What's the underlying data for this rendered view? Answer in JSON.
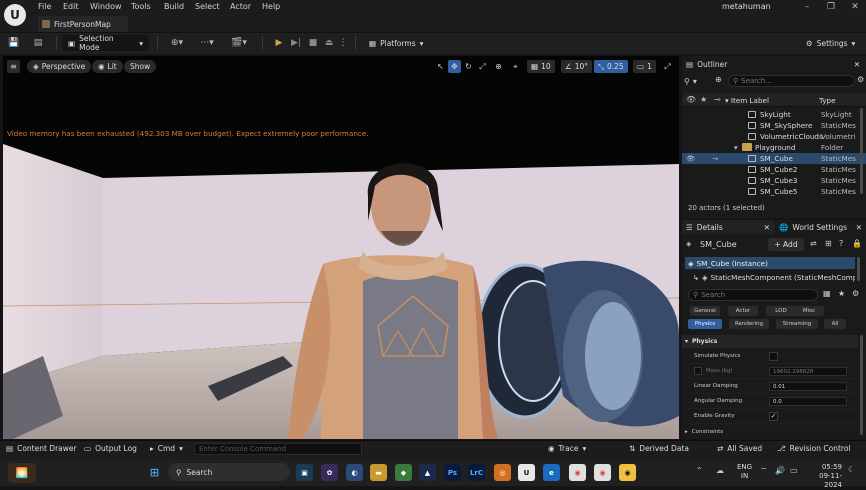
{
  "app": {
    "menus": [
      "File",
      "Edit",
      "Window",
      "Tools",
      "Build",
      "Select",
      "Actor",
      "Help"
    ],
    "doc_tab": "FirstPersonMap",
    "window_title": "metahuman"
  },
  "toolbar": {
    "selection_mode": "Selection Mode",
    "platforms": "Platforms",
    "settings": "Settings"
  },
  "viewport": {
    "perspective": "Perspective",
    "lit": "Lit",
    "show": "Show",
    "grid_snap": "10",
    "rotation_snap": "10°",
    "scale_snap": "0.25",
    "camera_speed": "1",
    "warning": "Video memory has been exhausted (492.303 MB over budget). Expect extremely poor performance."
  },
  "outliner": {
    "title": "Outliner",
    "search_placeholder": "Search...",
    "col_label": "Item Label",
    "col_type": "Type",
    "rows": [
      {
        "name": "SkyLight",
        "type": "SkyLight"
      },
      {
        "name": "SM_SkySphere",
        "type": "StaticMes"
      },
      {
        "name": "VolumetricClouds",
        "type": "Volumetri"
      },
      {
        "name": "Playground",
        "type": "Folder"
      },
      {
        "name": "SM_Cube",
        "type": "StaticMes"
      },
      {
        "name": "SM_Cube2",
        "type": "StaticMes"
      },
      {
        "name": "SM_Cube3",
        "type": "StaticMes"
      },
      {
        "name": "SM_Cube5",
        "type": "StaticMes"
      }
    ],
    "status": "20 actors (1 selected)"
  },
  "details": {
    "tab_details": "Details",
    "tab_world": "World Settings",
    "object_name": "SM_Cube",
    "add_label": "+ Add",
    "instance": "SM_Cube (Instance)",
    "component": "StaticMeshComponent (StaticMeshComponent)",
    "search_placeholder": "Search",
    "filters_row1": [
      "General",
      "Actor",
      "LOD",
      "Misc"
    ],
    "filters_row2": [
      "Physics",
      "Rendering",
      "Streaming",
      "All"
    ],
    "section_physics": "Physics",
    "props": {
      "simulate_physics": "Simulate Physics",
      "mass_label": "Mass (kg)",
      "mass_value": "19602.298828",
      "linear_damping_label": "Linear Damping",
      "linear_damping_value": "0.01",
      "angular_damping_label": "Angular Damping",
      "angular_damping_value": "0.0",
      "enable_gravity": "Enable Gravity"
    },
    "section_constraints": "Constraints"
  },
  "bottombar": {
    "content_drawer": "Content Drawer",
    "output_log": "Output Log",
    "cmd": "Cmd",
    "console_placeholder": "Enter Console Command",
    "trace": "Trace",
    "derived_data": "Derived Data",
    "all_saved": "All Saved",
    "revision_control": "Revision Control"
  },
  "taskbar": {
    "search_placeholder": "Search",
    "lang": "ENG",
    "region": "IN",
    "time": "05:59",
    "date": "09-11-2024"
  }
}
